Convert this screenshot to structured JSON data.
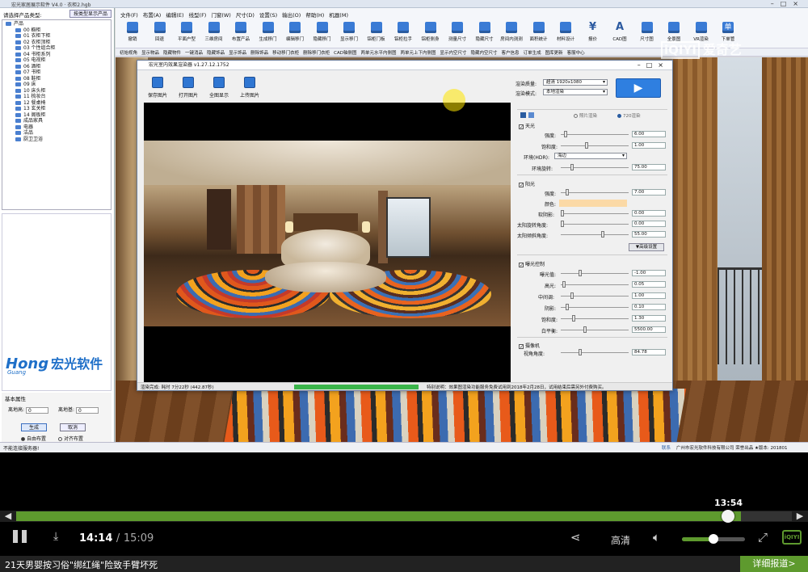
{
  "window": {
    "title": "宏光家居展示软件 V4.0 · 衣柜2.hgb"
  },
  "menu": [
    "文件(F)",
    "布置(A)",
    "编辑(E)",
    "线型(F)",
    "门窗(W)",
    "尺寸(D)",
    "设置(S)",
    "输出(O)",
    "帮助(H)",
    "机器(M)"
  ],
  "toolbar": [
    "撤销",
    "回退",
    "平面户型",
    "三维房间",
    "布置产品",
    "生成移门",
    "编辑移门",
    "隐藏移门",
    "显示移门",
    "铝柜门板",
    "铝柜拉手",
    "铝柜侧身",
    "测量尺寸",
    "隐藏尺寸",
    "房间内测测",
    "面积统计",
    "材料设计",
    "报价",
    "CAD图",
    "尺寸图",
    "全景图",
    "VR渲染",
    "下单管"
  ],
  "toolbar_icons": {
    "yen": "¥",
    "cad": "A",
    "single": "单"
  },
  "subbar": [
    "初始视角",
    "显示物品",
    "隐藏物件",
    "一键消品",
    "隐藏饰品",
    "显示饰品",
    "删除饰品",
    "移动移门衣柜",
    "删除移门衣柜",
    "CAD轴侧图",
    "两单元水平内侧图",
    "两单元上下内侧图",
    "显示内空尺寸",
    "隐藏内空尺寸",
    "客户信息",
    "订单生成",
    "图库更新",
    "客服中心"
  ],
  "left": {
    "product_type_label": "请选择产品类型:",
    "product_type_btn": "按类型显示产品",
    "tree_root": "产品",
    "tree_items": [
      "00 橱柜",
      "01 衣柜下柜",
      "02 衣柜顶柜",
      "03 个性组合柜",
      "04 书柜系列",
      "05 电视柜",
      "06 酒柜",
      "07 书柜",
      "08 鞋柜",
      "09 床",
      "10 床头柜",
      "11 梳妆台",
      "12 餐桌椅",
      "13 玄关柜",
      "14 阁板柜",
      "成品家具",
      "电器",
      "洁品",
      "厨卫卫浴"
    ],
    "logo_en": "Hong",
    "logo_en_sub": "Guang",
    "logo_cn": "宏光软件",
    "basic_title": "基本属性",
    "height_label": "离地高:",
    "height_value": "0",
    "floor_label": "离地基:",
    "floor_value": "0",
    "gen_btn": "生成",
    "cancel_btn": "取消",
    "radio_free": "自由布置",
    "radio_wall": "对齐布置",
    "status": "不能连接服务器!"
  },
  "dialog": {
    "title": "宏光室内效果渲染器 v1.27.12.1752",
    "btns": [
      "保存图片",
      "打开图片",
      "全图显示",
      "上传图片"
    ],
    "quality_label": "渲染质量:",
    "quality_value": "超清 1920x1080",
    "mode_label": "渲染模式:",
    "mode_value": "本地渲染",
    "render_btn": "▶",
    "radio_photo": "照片渲染",
    "radio_720": "720渲染",
    "sky_label": "天光",
    "sky_intensity_label": "强度:",
    "sky_intensity": "6.00",
    "sky_sat_label": "饱和度:",
    "sky_sat": "1.00",
    "env_label": "环境(HDR):",
    "env_value": "海边",
    "env_rot_label": "环境旋转:",
    "env_rot": "75.00",
    "sun_label": "阳光",
    "sun_intensity_label": "强度:",
    "sun_intensity": "7.00",
    "color_label": "颜色:",
    "shadow_label": "软阴影:",
    "shadow": "0.00",
    "sun_rot_label": "太阳旋转角度:",
    "sun_rot": "0.00",
    "sun_tilt_label": "太阳倾斜角度:",
    "sun_tilt": "55.00",
    "adv_btn": "▼高级设置",
    "exposure_label": "曝光控制",
    "exp_label": "曝光值:",
    "exp": "-1.00",
    "hl_label": "高光:",
    "hl": "0.05",
    "mid_label": "中间调:",
    "mid": "1.00",
    "dark_label": "阴影:",
    "dark": "0.10",
    "satur_label": "饱和度:",
    "satur": "1.30",
    "wb_label": "白平衡:",
    "wb": "5500.00",
    "camera_label": "摄像机",
    "fov_label": "视角角度:",
    "fov": "84.78",
    "progress_text": "渲染完成: 耗时 7分22秒 (442.87秒)",
    "progress_pct": 1.0,
    "note": "特别说明：效果图渲染功能服务免费试用到2018年2月28日，试用结束后需另外付费购买。"
  },
  "statusbar": {
    "link": "联系",
    "company": "广州市宏光软件科技有限公司 荣誉出品 ★版本: 201801"
  },
  "watermark": {
    "box": "iQIYI",
    "text": "爱奇艺"
  },
  "player": {
    "hover_time": "13:54",
    "current": "14:14",
    "separator": "/",
    "total": "15:09",
    "progress": 0.934,
    "hover_pos": 0.918,
    "quality": "高清",
    "volume": 0.5,
    "iqiyi": "iQIYI",
    "headline": "21天男婴按习俗\"绑红绳\"险致手臂坏死",
    "more": "详细报道>"
  }
}
